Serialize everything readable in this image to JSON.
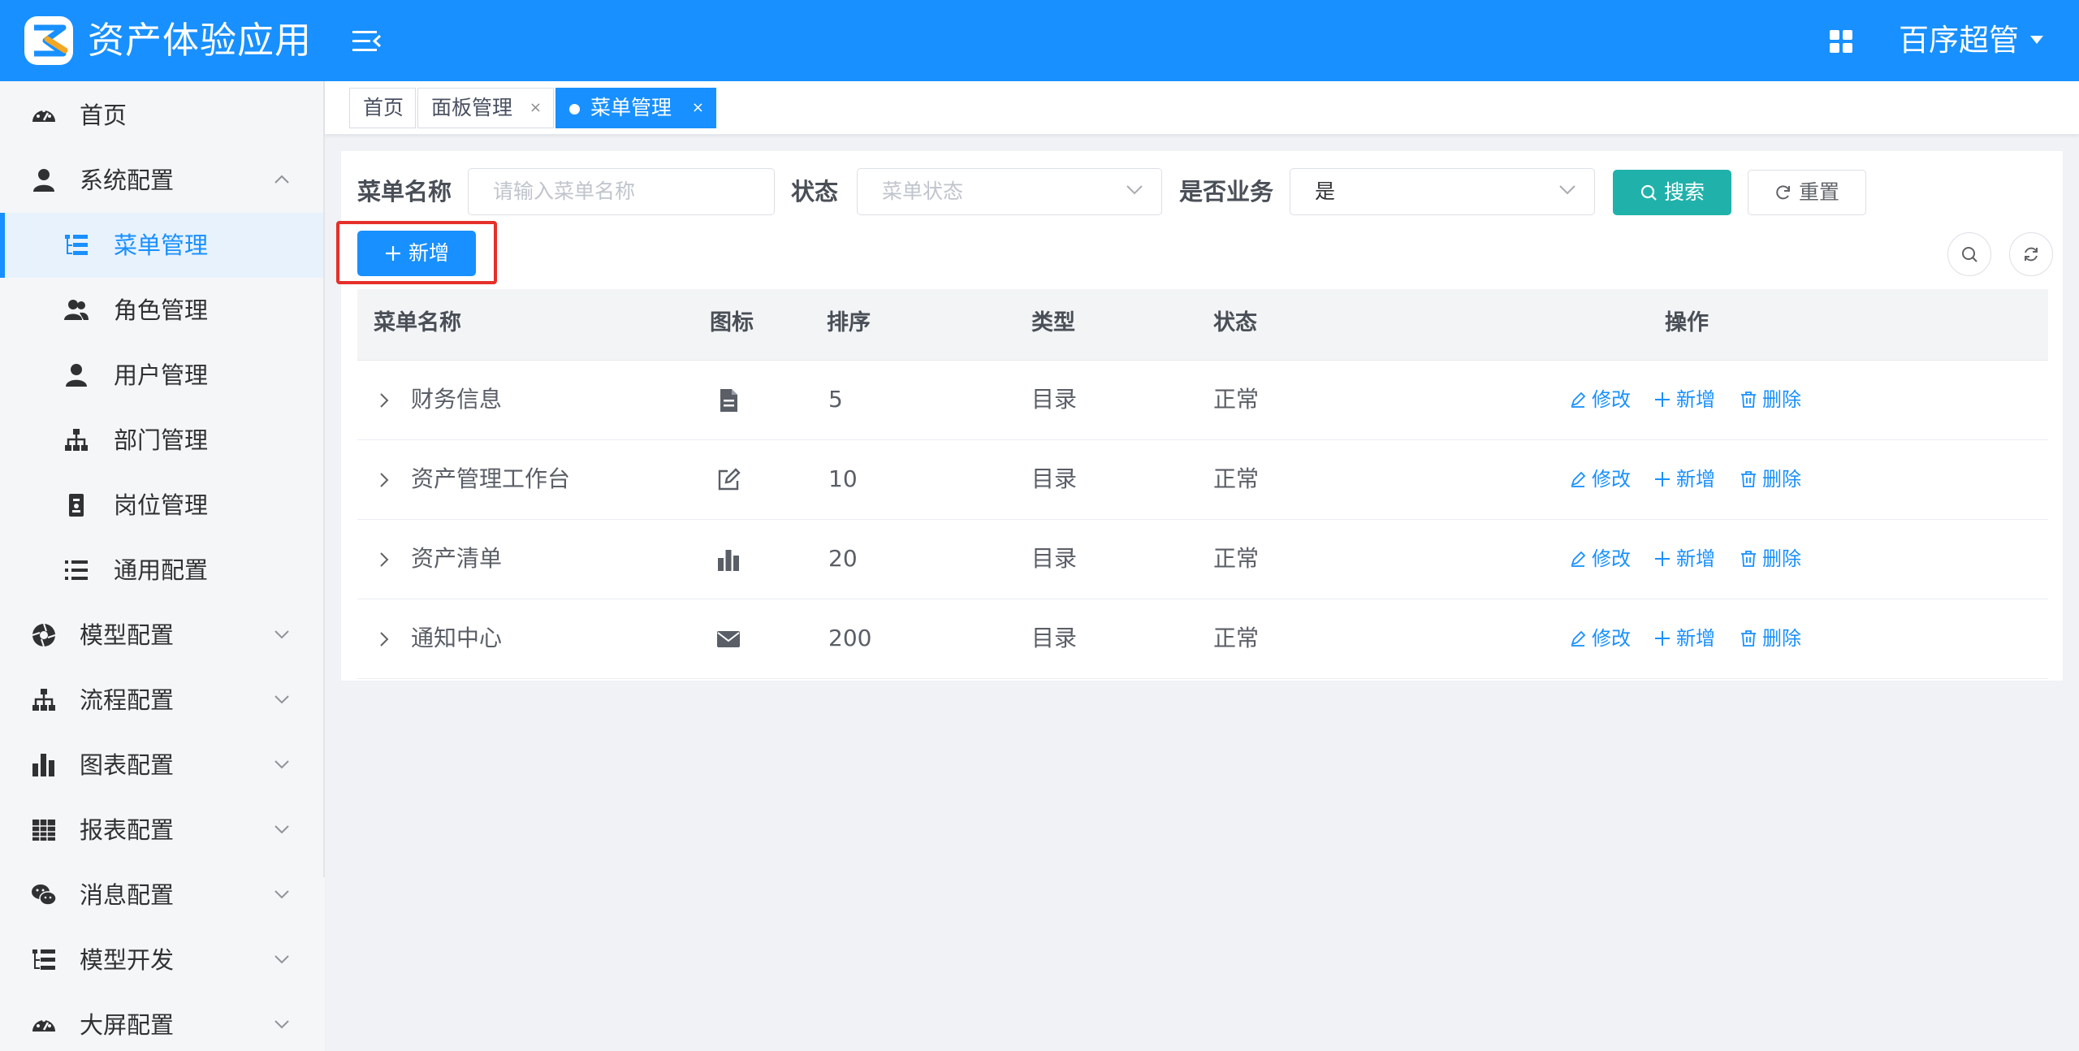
{
  "header": {
    "app_title": "资产体验应用",
    "user_name": "百序超管",
    "accent_color": "#1890ff"
  },
  "sidebar": {
    "items": [
      {
        "label": "首页",
        "icon": "dashboard-icon"
      },
      {
        "label": "系统配置",
        "icon": "user-icon",
        "expanded": true
      },
      {
        "label": "菜单管理",
        "icon": "tree-table-icon",
        "active": true
      },
      {
        "label": "角色管理",
        "icon": "users-icon"
      },
      {
        "label": "用户管理",
        "icon": "user-icon"
      },
      {
        "label": "部门管理",
        "icon": "org-tree-icon"
      },
      {
        "label": "岗位管理",
        "icon": "badge-icon"
      },
      {
        "label": "通用配置",
        "icon": "list-icon"
      },
      {
        "label": "模型配置",
        "icon": "aperture-icon"
      },
      {
        "label": "流程配置",
        "icon": "org-tree-icon"
      },
      {
        "label": "图表配置",
        "icon": "bar-chart-icon"
      },
      {
        "label": "报表配置",
        "icon": "table-icon"
      },
      {
        "label": "消息配置",
        "icon": "wechat-icon"
      },
      {
        "label": "模型开发",
        "icon": "tree-table-icon"
      },
      {
        "label": "大屏配置",
        "icon": "dashboard-icon"
      }
    ]
  },
  "tabs": [
    {
      "label": "首页"
    },
    {
      "label": "面板管理",
      "close": "×"
    },
    {
      "label": "菜单管理",
      "close": "×",
      "active": true
    }
  ],
  "filters": {
    "menu_name_label": "菜单名称",
    "menu_name_placeholder": "请输入菜单名称",
    "status_label": "状态",
    "status_placeholder": "菜单状态",
    "business_label": "是否业务",
    "business_value": "是",
    "search_button": "搜索",
    "reset_button": "重置",
    "add_button": "新增"
  },
  "table": {
    "columns": [
      "菜单名称",
      "图标",
      "排序",
      "类型",
      "状态",
      "操作"
    ],
    "rows": [
      {
        "name": "财务信息",
        "icon": "document-icon",
        "order": "5",
        "type": "目录",
        "status": "正常"
      },
      {
        "name": "资产管理工作台",
        "icon": "edit-icon",
        "order": "10",
        "type": "目录",
        "status": "正常"
      },
      {
        "name": "资产清单",
        "icon": "bar-chart-icon",
        "order": "20",
        "type": "目录",
        "status": "正常"
      },
      {
        "name": "通知中心",
        "icon": "mail-icon",
        "order": "200",
        "type": "目录",
        "status": "正常"
      }
    ],
    "actions": {
      "edit": "修改",
      "add": "新增",
      "delete": "删除"
    }
  }
}
